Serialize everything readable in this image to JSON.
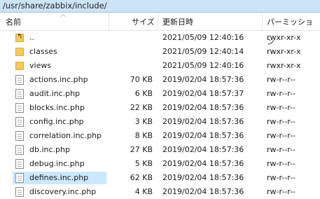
{
  "path": "/usr/share/zabbix/include/",
  "columns": {
    "name": "名前",
    "size": "サイズ",
    "modified": "更新日時",
    "perm": "パーミッション"
  },
  "rows": [
    {
      "name": "..",
      "size": "",
      "date": "2021/05/09 12:40:16",
      "perm": "rwxr-xr-x",
      "icon": "up-folder-icon"
    },
    {
      "name": "classes",
      "size": "",
      "date": "2021/05/09 12:40:14",
      "perm": "rwxr-xr-x",
      "icon": "folder-icon"
    },
    {
      "name": "views",
      "size": "",
      "date": "2021/05/09 12:40:16",
      "perm": "rwxr-xr-x",
      "icon": "folder-icon"
    },
    {
      "name": "actions.inc.php",
      "size": "70 KB",
      "date": "2019/02/04 18:57:36",
      "perm": "rw-r--r--",
      "icon": "file-icon"
    },
    {
      "name": "audit.inc.php",
      "size": "6 KB",
      "date": "2019/02/04 18:57:37",
      "perm": "rw-r--r--",
      "icon": "file-icon"
    },
    {
      "name": "blocks.inc.php",
      "size": "22 KB",
      "date": "2019/02/04 18:57:36",
      "perm": "rw-r--r--",
      "icon": "file-icon"
    },
    {
      "name": "config.inc.php",
      "size": "3 KB",
      "date": "2019/02/04 18:57:36",
      "perm": "rw-r--r--",
      "icon": "file-icon"
    },
    {
      "name": "correlation.inc.php",
      "size": "8 KB",
      "date": "2019/02/04 18:57:36",
      "perm": "rw-r--r--",
      "icon": "file-icon"
    },
    {
      "name": "db.inc.php",
      "size": "27 KB",
      "date": "2019/02/04 18:57:36",
      "perm": "rw-r--r--",
      "icon": "file-icon"
    },
    {
      "name": "debug.inc.php",
      "size": "5 KB",
      "date": "2019/02/04 18:57:36",
      "perm": "rw-r--r--",
      "icon": "file-icon"
    },
    {
      "name": "defines.inc.php",
      "size": "62 KB",
      "date": "2019/02/04 18:57:36",
      "perm": "rw-r--r--",
      "icon": "file-icon",
      "selected": true
    },
    {
      "name": "discovery.inc.php",
      "size": "4 KB",
      "date": "2019/02/04 18:57:36",
      "perm": "rw-r--r--",
      "icon": "file-icon"
    }
  ]
}
